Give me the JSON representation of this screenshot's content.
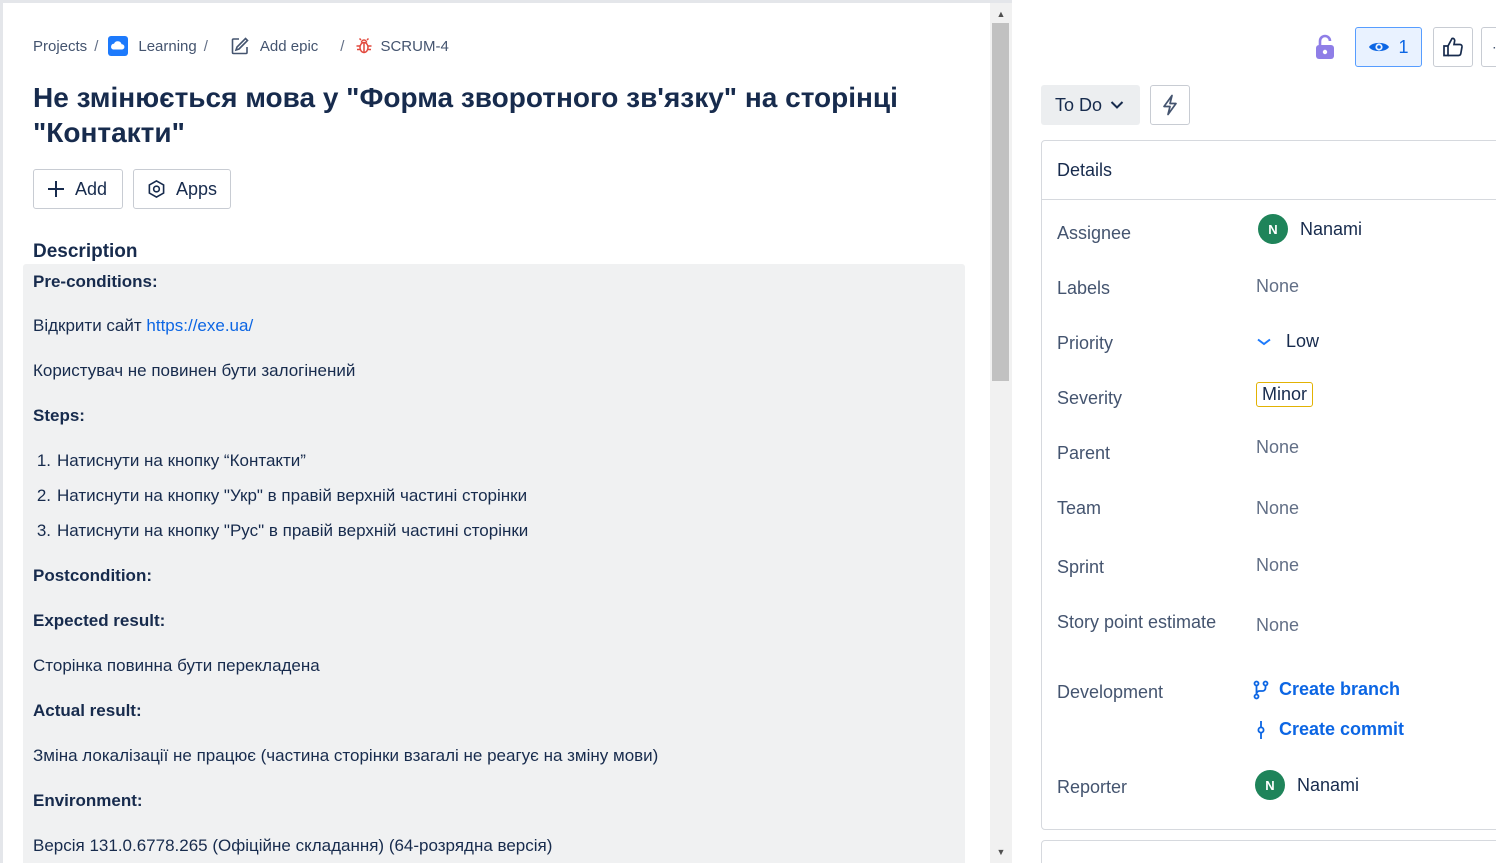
{
  "breadcrumb": {
    "projects": "Projects",
    "separator": "/",
    "project": "Learning",
    "epic": "Add epic",
    "issue_key": "SCRUM-4"
  },
  "issue": {
    "title": "Не змінюється мова у \"Форма зворотного зв'язку\" на сторінці \"Контакти\""
  },
  "actions": {
    "add_label": "Add",
    "apps_label": "Apps"
  },
  "description": {
    "heading": "Description",
    "preconditions_heading": "Pre-conditions:",
    "open_site_text": "Відкрити сайт ",
    "open_site_link": "https://exe.ua/",
    "user_not_logged": "Користувач не повинен бути залогінений",
    "steps_heading": "Steps:",
    "steps": [
      {
        "num": "1.",
        "text": "Натиснути на кнопку “Контакти”"
      },
      {
        "num": "2.",
        "text": "Натиснути на кнопку \"Укр\" в правій верхній частині сторінки"
      },
      {
        "num": "3.",
        "text": "Натиснути на кнопку \"Рус\" в правій верхній частині сторінки"
      }
    ],
    "postcondition_heading": "Postcondition:",
    "expected_heading": "Expected result:",
    "expected_text": "Сторінка повинна бути перекладена",
    "actual_heading": "Actual result:",
    "actual_text": "Зміна локалізації не працює (частина сторінки взагалі не реагує на зміну мови)",
    "environment_heading": "Environment:",
    "environment_text": "Версія 131.0.6778.265 (Офіційне складання) (64-розрядна версія)"
  },
  "toolbar": {
    "watchers_count": "1"
  },
  "status": {
    "label": "To Do"
  },
  "details": {
    "header": "Details",
    "assignee_label": "Assignee",
    "assignee_initial": "N",
    "assignee_name": "Nanami",
    "labels_label": "Labels",
    "labels_value": "None",
    "priority_label": "Priority",
    "priority_value": "Low",
    "severity_label": "Severity",
    "severity_value": "Minor",
    "parent_label": "Parent",
    "parent_value": "None",
    "team_label": "Team",
    "team_value": "None",
    "sprint_label": "Sprint",
    "sprint_value": "None",
    "story_points_label": "Story point estimate",
    "story_points_value": "None",
    "development_label": "Development",
    "create_branch": "Create branch",
    "create_commit": "Create commit",
    "reporter_label": "Reporter",
    "reporter_initial": "N",
    "reporter_name": "Nanami"
  },
  "colors": {
    "link": "#0c66e4",
    "watch_bg": "#e9f2ff",
    "lock": "#8f7ee7",
    "bug": "#e2483d",
    "avatar": "#1f845a",
    "severity_border": "#e2b203"
  }
}
